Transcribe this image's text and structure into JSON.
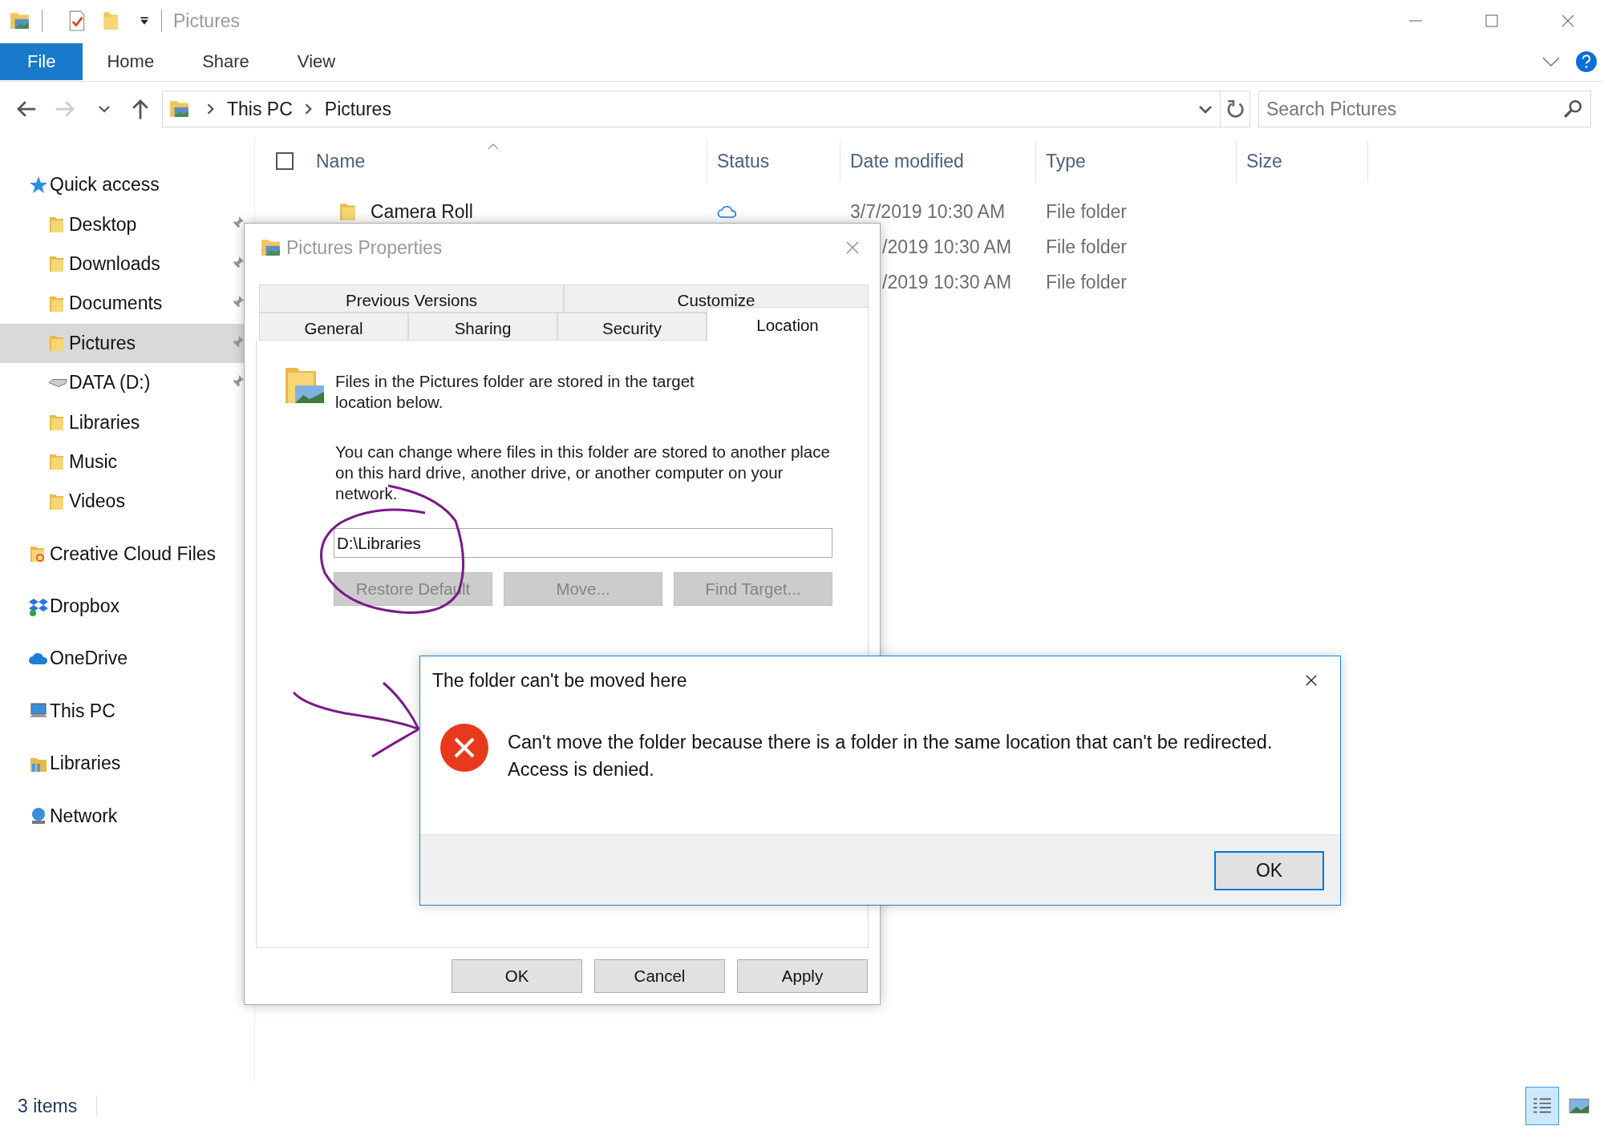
{
  "window": {
    "title": "Pictures"
  },
  "ribbon_tabs": [
    {
      "label": "File",
      "kind": "file"
    },
    {
      "label": "Home",
      "kind": "tab"
    },
    {
      "label": "Share",
      "kind": "tab"
    },
    {
      "label": "View",
      "kind": "tab"
    }
  ],
  "address": {
    "path": [
      "This PC",
      "Pictures"
    ]
  },
  "search": {
    "placeholder": "Search Pictures"
  },
  "sidebar": {
    "items": [
      {
        "label": "Quick access",
        "kind": "star",
        "selected": false,
        "children": [
          {
            "label": "Desktop",
            "kind": "folder",
            "selected": false,
            "pinned": true
          },
          {
            "label": "Downloads",
            "kind": "folder",
            "selected": false,
            "pinned": true
          },
          {
            "label": "Documents",
            "kind": "folder",
            "selected": false,
            "pinned": true
          },
          {
            "label": "Pictures",
            "kind": "folder",
            "selected": true,
            "pinned": true
          },
          {
            "label": "DATA (D:)",
            "kind": "drive",
            "selected": false,
            "pinned": true
          },
          {
            "label": "Libraries",
            "kind": "folder",
            "selected": false,
            "pinned": false
          },
          {
            "label": "Music",
            "kind": "folder",
            "selected": false,
            "pinned": false
          },
          {
            "label": "Videos",
            "kind": "folder",
            "selected": false,
            "pinned": false
          }
        ]
      },
      {
        "label": "Creative Cloud Files",
        "kind": "folder",
        "selected": false
      },
      {
        "label": "Dropbox",
        "kind": "dropbox",
        "selected": false
      },
      {
        "label": "OneDrive",
        "kind": "cloud",
        "selected": false
      },
      {
        "label": "This PC",
        "kind": "computer",
        "selected": false
      },
      {
        "label": "Libraries",
        "kind": "library",
        "selected": false
      },
      {
        "label": "Network",
        "kind": "network",
        "selected": false
      }
    ]
  },
  "table": {
    "select_all_checked": false,
    "columns": [
      "Name",
      "Status",
      "Date modified",
      "Type",
      "Size"
    ],
    "rows": [
      {
        "name": "Camera Roll",
        "cloud_status": true,
        "date_modified": "3/7/2019 10:30 AM",
        "type": "File folder"
      },
      {
        "date_modified": "/2019 10:30 AM",
        "type": "File folder"
      },
      {
        "date_modified": "/2019 10:30 AM",
        "type": "File folder"
      }
    ]
  },
  "status_bar": {
    "item_count": "3 items"
  },
  "properties_dialog": {
    "title": "Pictures Properties",
    "tabs_back_row": [
      {
        "label": "Previous Versions",
        "selected": false
      },
      {
        "label": "Customize",
        "selected": false
      }
    ],
    "tabs_front_row": [
      {
        "label": "General",
        "selected": false
      },
      {
        "label": "Sharing",
        "selected": false
      },
      {
        "label": "Security",
        "selected": false
      },
      {
        "label": "Location",
        "selected": true
      }
    ],
    "intro": "Files in the Pictures folder are stored in the target location below.",
    "description": "You can change where files in this folder are stored to another place on this hard drive, another drive, or another computer on your network.",
    "location": "D:\\Libraries",
    "action_buttons": [
      {
        "label": "Restore Default",
        "disabled": true
      },
      {
        "label": "Move...",
        "disabled": true
      },
      {
        "label": "Find Target...",
        "disabled": true
      }
    ],
    "buttons": [
      "OK",
      "Cancel",
      "Apply"
    ]
  },
  "error_dialog": {
    "title": "The folder can't be moved here",
    "message_lines": [
      "Can't move the folder because there is a folder in the same location that can't be redirected.",
      "Access is denied."
    ],
    "button": "OK"
  }
}
